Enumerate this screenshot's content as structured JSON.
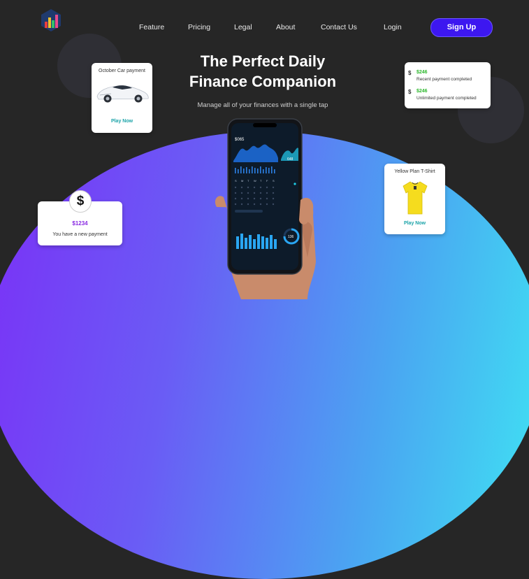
{
  "nav": {
    "items": [
      "Feature",
      "Pricing",
      "Legal",
      "About",
      "Contact Us",
      "Login"
    ],
    "signup_label": "Sign Up"
  },
  "hero": {
    "title_line1": "The Perfect Daily",
    "title_line2": "Finance Companion",
    "subtitle": "Manage all of your finances with a single tap"
  },
  "cards": {
    "car": {
      "title": "October Car payment",
      "action": "Play Now"
    },
    "shirt": {
      "title": "Yellow Plan T-Shirt",
      "action": "Play Now"
    },
    "notifications": [
      {
        "amount": "$246",
        "text": "Recent payment completed"
      },
      {
        "amount": "$246",
        "text": "Unlimited payment completed"
      }
    ],
    "payment": {
      "symbol": "$",
      "amount": "$1234",
      "text": "You have a new payment"
    }
  },
  "phone_screen": {
    "balance": "$065",
    "side_value": "648",
    "bottom_value": "136",
    "weekdays": [
      "S",
      "M",
      "T",
      "W",
      "T",
      "F",
      "S"
    ]
  },
  "colors": {
    "background": "#262626",
    "accent": "#3d17f0",
    "gradient_start": "#7b2ff7",
    "gradient_end": "#3ee6f3",
    "play_link": "#1aa3a8",
    "amount_green": "#2db82d",
    "amount_purple": "#8a2be2"
  },
  "icons": {
    "logo": "bar-chart-logo-icon",
    "currency": "dollar-icon"
  }
}
